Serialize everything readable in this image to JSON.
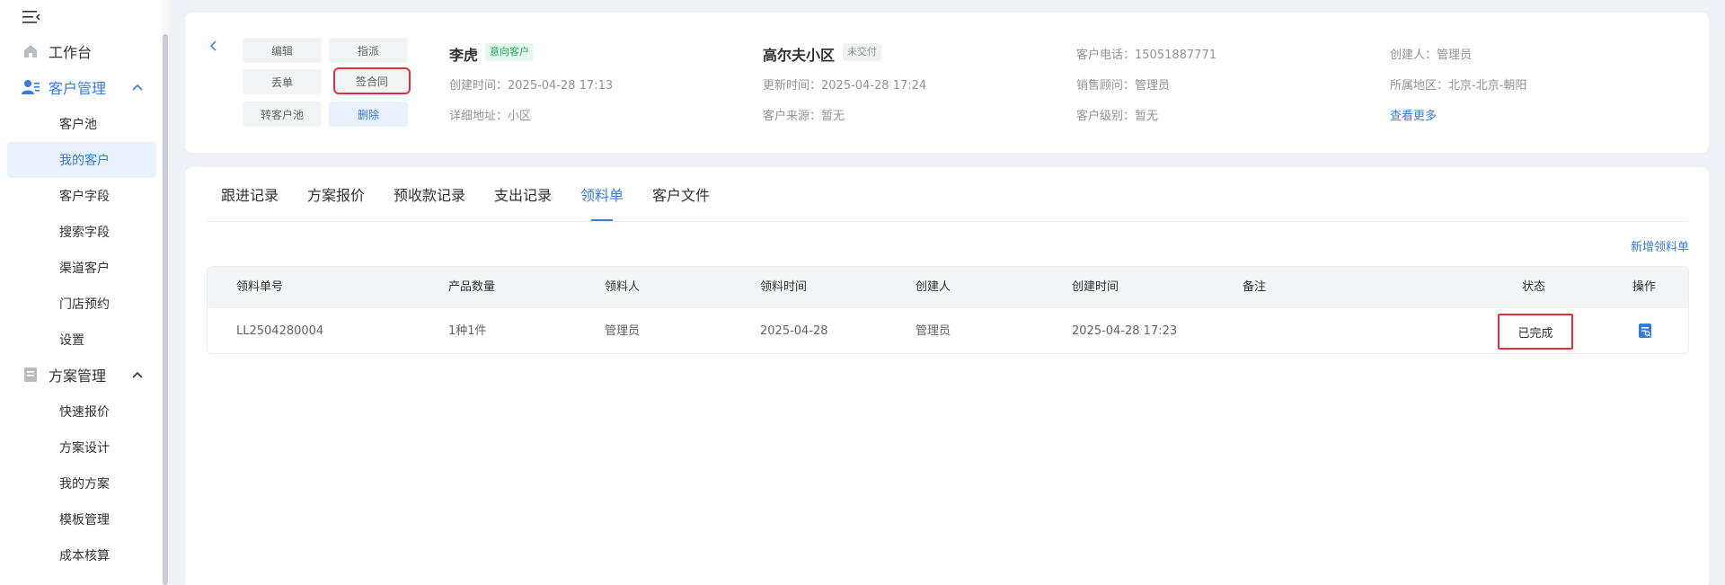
{
  "sidebar": {
    "groups": [
      {
        "label": "工作台",
        "icon": "home-icon"
      },
      {
        "label": "客户管理",
        "icon": "customer-icon"
      },
      {
        "label": "方案管理",
        "icon": "document-icon"
      }
    ],
    "customer_items": [
      "客户池",
      "我的客户",
      "客户字段",
      "搜索字段",
      "渠道客户",
      "门店预约",
      "设置"
    ],
    "plan_items": [
      "快速报价",
      "方案设计",
      "我的方案",
      "模板管理",
      "成本核算"
    ]
  },
  "actions": {
    "edit": "编辑",
    "assign": "指派",
    "lose": "丢单",
    "sign": "签合同",
    "to_pool": "转客户池",
    "delete": "删除"
  },
  "customer": {
    "name": "李虎",
    "name_tag": "意向客户",
    "created_label": "创建时间：",
    "created": "2025-04-28 17:13",
    "address_label": "详细地址：",
    "address": "小区",
    "project": "高尔夫小区",
    "project_tag": "未交付",
    "updated_label": "更新时间：",
    "updated": "2025-04-28 17:24",
    "source_label": "客户来源：",
    "source": "暂无",
    "phone_label": "客户电话：",
    "phone": "15051887771",
    "sales_label": "销售顾问：",
    "sales": "管理员",
    "level_label": "客户级别：",
    "level": "暂无",
    "creator_label": "创建人：",
    "creator": "管理员",
    "region_label": "所属地区：",
    "region": "北京-北京-朝阳",
    "more": "查看更多"
  },
  "tabs": [
    "跟进记录",
    "方案报价",
    "预收款记录",
    "支出记录",
    "领料单",
    "客户文件"
  ],
  "add_button": "新增领料单",
  "table": {
    "headers": [
      "领料单号",
      "产品数量",
      "领料人",
      "领料时间",
      "创建人",
      "创建时间",
      "备注",
      "状态",
      "操作"
    ],
    "rows": [
      {
        "no": "LL2504280004",
        "qty": "1种1件",
        "picker": "管理员",
        "pick_time": "2025-04-28",
        "creator": "管理员",
        "created": "2025-04-28 17:23",
        "remark": "",
        "status": "已完成"
      }
    ]
  },
  "colors": {
    "primary": "#3a7bd5",
    "highlight": "#e0313b",
    "success": "#1fa45c"
  }
}
